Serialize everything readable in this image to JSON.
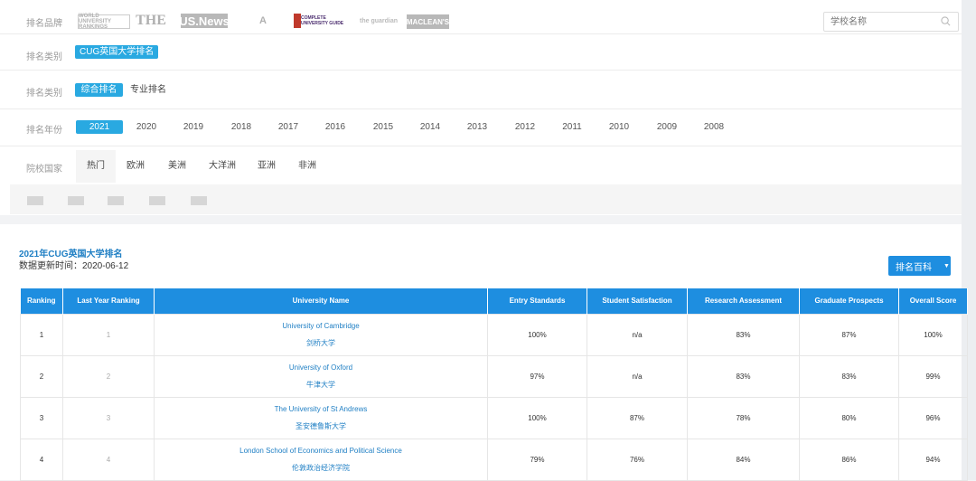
{
  "filters": {
    "brand_label": "排名品牌",
    "brands": [
      "WORLD UNIVERSITY RANKINGS",
      "THE",
      "US.News",
      "A",
      "COMPLETE UNIVERSITY GUIDE",
      "the guardian",
      "MACLEAN'S"
    ],
    "search_placeholder": "学校名称",
    "category_label": "排名类别",
    "category_value": "CUG英国大学排名",
    "type_label": "排名类别",
    "type_options": [
      "综合排名",
      "专业排名"
    ],
    "year_label": "排名年份",
    "years": [
      "2021",
      "2020",
      "2019",
      "2018",
      "2017",
      "2016",
      "2015",
      "2014",
      "2013",
      "2012",
      "2011",
      "2010",
      "2009",
      "2008"
    ],
    "country_label": "院校国家",
    "regions": [
      "热门",
      "欧洲",
      "美洲",
      "大洋洲",
      "亚洲",
      "非洲"
    ]
  },
  "ranking": {
    "title": "2021年CUG英国大学排名",
    "updated": "数据更新时间：2020-06-12",
    "wiki_button": "排名百科",
    "columns": [
      "Ranking",
      "Last Year Ranking",
      "University Name",
      "Entry Standards",
      "Student Satisfaction",
      "Research Assessment",
      "Graduate Prospects",
      "Overall Score"
    ],
    "rows": [
      {
        "rank": "1",
        "last": "1",
        "name_en": "University of Cambridge",
        "name_cn": "剑桥大学",
        "entry": "100%",
        "satisfaction": "n/a",
        "research": "83%",
        "prospects": "87%",
        "overall": "100%"
      },
      {
        "rank": "2",
        "last": "2",
        "name_en": "University of Oxford",
        "name_cn": "牛津大学",
        "entry": "97%",
        "satisfaction": "n/a",
        "research": "83%",
        "prospects": "83%",
        "overall": "99%"
      },
      {
        "rank": "3",
        "last": "3",
        "name_en": "The University of St Andrews",
        "name_cn": "圣安德鲁斯大学",
        "entry": "100%",
        "satisfaction": "87%",
        "research": "78%",
        "prospects": "80%",
        "overall": "96%"
      },
      {
        "rank": "4",
        "last": "4",
        "name_en": "London School of Economics and Political Science",
        "name_cn": "伦敦政治经济学院",
        "entry": "79%",
        "satisfaction": "76%",
        "research": "84%",
        "prospects": "86%",
        "overall": "94%"
      }
    ]
  },
  "colors": {
    "accent": "#29a9e1",
    "header": "#1e8ee0",
    "link": "#1f7fc4"
  }
}
